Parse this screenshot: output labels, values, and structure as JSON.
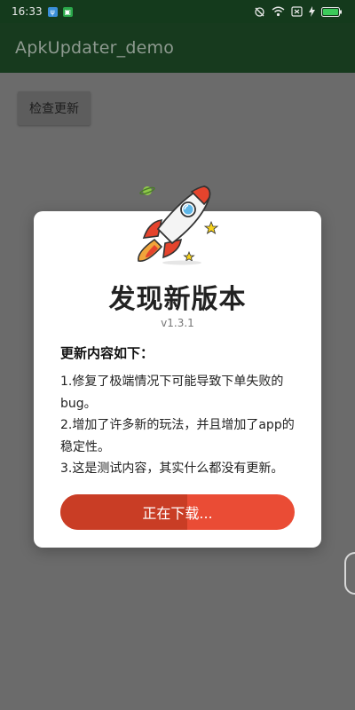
{
  "status_bar": {
    "time": "16:33",
    "icons": [
      "usb-icon",
      "notification-icon",
      "sync-icon",
      "wifi-icon",
      "sim-icon",
      "charging-icon",
      "battery-icon"
    ]
  },
  "app_bar": {
    "title": "ApkUpdater_demo"
  },
  "main": {
    "check_button_label": "检查更新"
  },
  "dialog": {
    "title": "发现新版本",
    "version": "v1.3.1",
    "notes_heading": "更新内容如下：",
    "notes_lines": [
      "1.修复了极端情况下可能导致下单失败的",
      "bug。",
      "2.增加了许多新的玩法，并且增加了app的",
      "稳定性。",
      "3.这是测试内容，其实什么都没有更新。"
    ],
    "progress_label": "正在下载...",
    "progress": 0.54
  },
  "colors": {
    "status_bar": "#143a1c",
    "app_bar": "#173a1e",
    "overlay_bg": "#6b6b6b",
    "button_accent": "#ea4c35",
    "button_progress": "#c93d25"
  }
}
